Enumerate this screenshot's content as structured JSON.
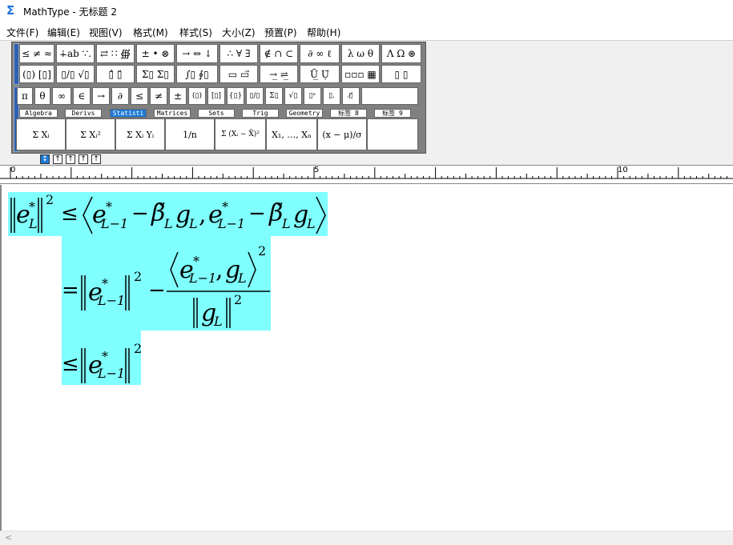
{
  "window": {
    "title": "MathType - 无标题 2",
    "app_icon": "sigma-icon",
    "accent_color": "#1e7ad6",
    "highlight_color": "#80ffff"
  },
  "menu": [
    {
      "label": "文件(F)"
    },
    {
      "label": "编辑(E)"
    },
    {
      "label": "视图(V)"
    },
    {
      "label": "格式(M)"
    },
    {
      "label": "样式(S)"
    },
    {
      "label": "大小(Z)"
    },
    {
      "label": "预置(P)"
    },
    {
      "label": "帮助(H)"
    }
  ],
  "palette_row1": [
    "≤ ≠ ≈",
    "∔ab ∵.",
    "⇄ ∷ ∰",
    "± • ⊗",
    "→ ⇔ ↓",
    "∴ ∀ ∃",
    "∉ ∩ ⊂",
    "∂ ∞ ℓ",
    "λ ω θ",
    "Λ Ω ⊛"
  ],
  "palette_row2": [
    "(▯) [▯]",
    "▯/▯ √▯",
    "▯̂ ▯̈",
    "Σ▯ Σ▯",
    "∫▯ ∮▯",
    "▭ ▭⃗",
    "→̲ ⇌̲",
    "Ū̲ Ụ̈",
    "▫▫▫ ▦",
    "▯ ▯"
  ],
  "palette_row3": [
    "π",
    "θ",
    "∞",
    "∈",
    "→",
    "∂",
    "≤",
    "≠",
    "±",
    "(▯)",
    "[▯]",
    "{▯}",
    "▯/▯",
    "Σ▯",
    "√▯",
    "▯ˣ",
    "▯.",
    "▯̸"
  ],
  "tabs": [
    {
      "label": "Algebra"
    },
    {
      "label": "Derivs"
    },
    {
      "label": "Statisti"
    },
    {
      "label": "Matrices"
    },
    {
      "label": "Sets"
    },
    {
      "label": "Trig"
    },
    {
      "label": "Geometry"
    },
    {
      "label": "标签 8"
    },
    {
      "label": "标签 9"
    }
  ],
  "active_tab": "Statisti",
  "templates": [
    {
      "label": "Σ Xᵢ"
    },
    {
      "label": "Σ Xᵢ²"
    },
    {
      "label": "Σ Xᵢ Yᵢ"
    },
    {
      "label": "1/n"
    },
    {
      "label": "Σ (Xᵢ − X̄)²"
    },
    {
      "label": "X₁, …, Xₙ"
    },
    {
      "label": "(x − μ)/σ"
    }
  ],
  "size_buttons": [
    "↕",
    "↑",
    "↑",
    "↑",
    "↑"
  ],
  "ruler": {
    "labels": [
      "0",
      "5",
      "10"
    ]
  },
  "equation": {
    "line1": {
      "lhs_norm_var": "e",
      "lhs_sup": "*",
      "lhs_sub": "L",
      "power": "2",
      "rel": "≤",
      "inner_left": "e",
      "inner_sup": "*",
      "inner_sub": "L−1",
      "minus": "−",
      "beta": "β̃",
      "beta_sub": "L",
      "g": "g",
      "g_sub": "L",
      "comma": ","
    },
    "line2": {
      "rel": "=",
      "norm_var": "e",
      "norm_sup": "*",
      "norm_sub": "L−1",
      "power": "2",
      "minus": "−",
      "num_e": "e",
      "num_sup": "*",
      "num_sub": "L−1",
      "num_comma": ",",
      "num_g": "g",
      "num_g_sub": "L",
      "num_power": "2",
      "den_g": "g",
      "den_g_sub": "L",
      "den_power": "2"
    },
    "line3": {
      "rel": "≤",
      "norm_var": "e",
      "norm_sup": "*",
      "norm_sub": "L−1",
      "power": "2"
    }
  },
  "scroll_left_arrow": "<"
}
